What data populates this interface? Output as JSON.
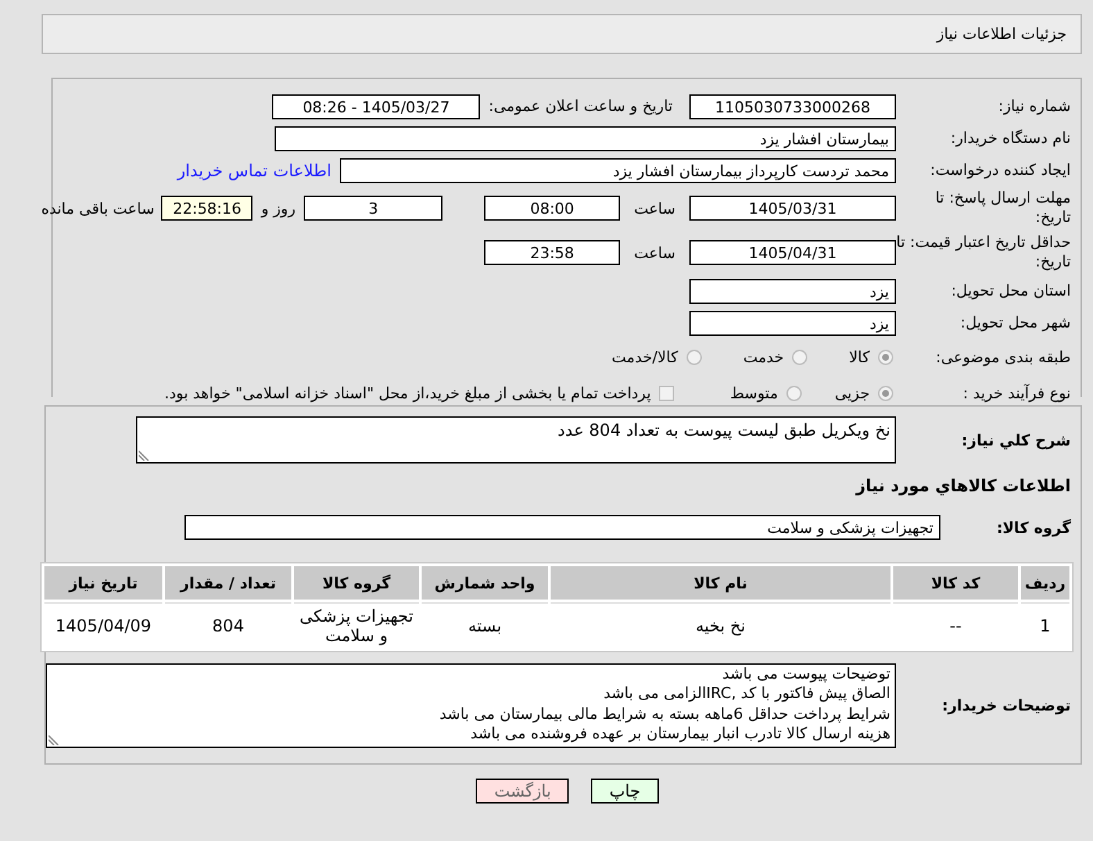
{
  "header": {
    "title": "جزئیات اطلاعات نیاز"
  },
  "need_number": {
    "label": "شماره نیاز:",
    "value": "1105030733000268"
  },
  "announce": {
    "label": "تاریخ و ساعت اعلان عمومی:",
    "value": "1405/03/27 - 08:26"
  },
  "buyer_org": {
    "label": "نام دستگاه خریدار:",
    "value": "بیمارستان افشار یزد"
  },
  "requester": {
    "label": "ایجاد کننده درخواست:",
    "value": "محمد تردست کارپرداز بیمارستان افشار یزد",
    "link": "اطلاعات تماس خریدار"
  },
  "reply_deadline": {
    "label": "مهلت ارسال پاسخ: تا تاریخ:",
    "date": "1405/03/31",
    "time_label": "ساعت",
    "time": "08:00",
    "days": "3",
    "days_label": "روز و",
    "remaining": "22:58:16",
    "remaining_label": "ساعت باقی مانده"
  },
  "price_validity": {
    "label": "حداقل تاریخ اعتبار قیمت: تا تاریخ:",
    "date": "1405/04/31",
    "time_label": "ساعت",
    "time": "23:58"
  },
  "delivery_province": {
    "label": "استان محل تحویل:",
    "value": "یزد"
  },
  "delivery_city": {
    "label": "شهر محل تحویل:",
    "value": "یزد"
  },
  "category": {
    "label": "طبقه بندی موضوعی:",
    "options": [
      {
        "label": "کالا",
        "selected": true
      },
      {
        "label": "خدمت",
        "selected": false
      },
      {
        "label": "کالا/خدمت",
        "selected": false
      }
    ]
  },
  "process": {
    "label": "نوع فرآیند خرید :",
    "options": [
      {
        "label": "جزیی",
        "selected": true
      },
      {
        "label": "متوسط",
        "selected": false
      }
    ],
    "checkbox": {
      "label": "پرداخت تمام یا بخشی از مبلغ خرید،از محل \"اسناد خزانه اسلامی\" خواهد بود.",
      "checked": false
    }
  },
  "description": {
    "label": "شرح کلي نياز:",
    "value": "نخ ویکریل طبق لیست پیوست به تعداد 804 عدد"
  },
  "goods_heading": "اطلاعات کالاهاي مورد نياز",
  "goods_group": {
    "label": "گروه کالا:",
    "value": "تجهیزات پزشکی و سلامت"
  },
  "table": {
    "columns": [
      "ردیف",
      "کد کالا",
      "نام کالا",
      "واحد شمارش",
      "گروه کالا",
      "تعداد / مقدار",
      "تاریخ نیاز"
    ],
    "rows": [
      [
        "1",
        "--",
        "نخ بخیه",
        "بسته",
        "تجهیزات پزشکی و سلامت",
        "804",
        "1405/04/09"
      ]
    ]
  },
  "buyer_notes": {
    "label": "توضیحات خریدار:",
    "lines": [
      "توضیحات پیوست می باشد",
      "الصاق پیش فاکتور با کد ,IRCالزامی می باشد",
      "شرایط پرداخت حداقل 6ماهه بسته به شرایط مالی بیمارستان می باشد",
      "هزینه ارسال کالا تادرب انبار بیمارستان بر عهده فروشنده می باشد"
    ]
  },
  "buttons": [
    {
      "label": "چاپ",
      "kind": "print"
    },
    {
      "label": "بازگشت",
      "kind": "back"
    }
  ]
}
